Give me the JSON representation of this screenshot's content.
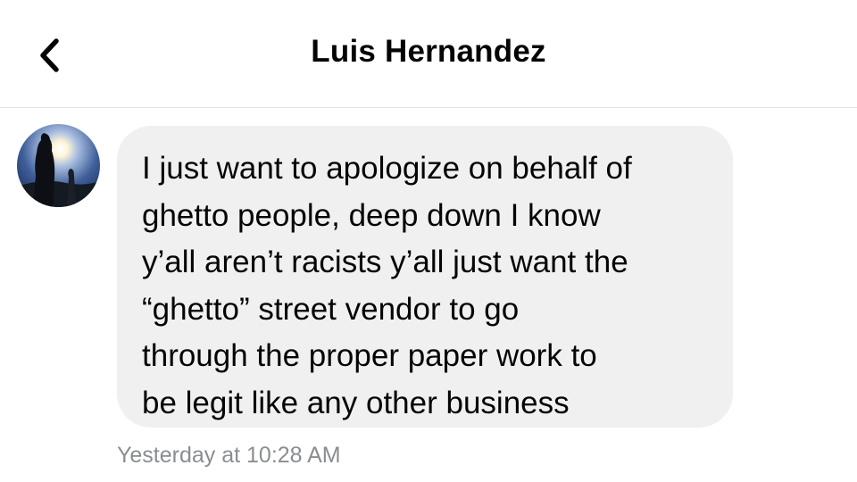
{
  "header": {
    "title": "Luis Hernandez",
    "back_icon": "chevron-left-icon"
  },
  "message": {
    "lines": [
      "I just want to apologize on behalf of",
      "ghetto people, deep down I know",
      "y’all aren’t racists y’all just want the",
      "“ghetto” street vendor to go",
      "through the proper paper work to",
      "be legit like any other business"
    ],
    "timestamp": "Yesterday at 10:28 AM",
    "bubble_color": "#f0f0f0"
  },
  "colors": {
    "text": "#050505",
    "timestamp": "#8a8d91",
    "divider": "#e4e4e6"
  }
}
